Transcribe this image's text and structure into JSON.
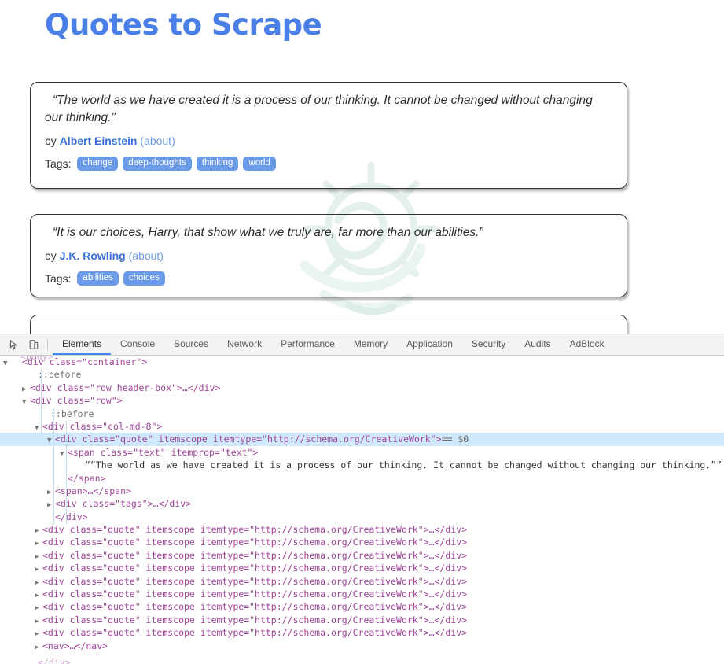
{
  "site": {
    "title": "Quotes to Scrape",
    "title_color": "#4a7fe8",
    "tag_color": "#6b9ae8",
    "author_link_color": "#3a6fd8",
    "about_link_color": "#6f9ae8",
    "by_label": "by",
    "about_label": "(about)",
    "tags_label": "Tags:",
    "watermark": "hand-holding-sun-watermark"
  },
  "quotes": [
    {
      "text": "“The world as we have created it is a process of our thinking. It cannot be changed without changing our thinking.”",
      "author": "Albert Einstein",
      "tags": [
        "change",
        "deep-thoughts",
        "thinking",
        "world"
      ]
    },
    {
      "text": "“It is our choices, Harry, that show what we truly are, far more than our abilities.”",
      "author": "J.K. Rowling",
      "tags": [
        "abilities",
        "choices"
      ]
    }
  ],
  "devtools": {
    "toolbar": {
      "inspect_icon": "inspect-element-icon",
      "device_icon": "device-toolbar-icon",
      "tabs": [
        {
          "label": "Elements",
          "active": true
        },
        {
          "label": "Console",
          "active": false
        },
        {
          "label": "Sources",
          "active": false
        },
        {
          "label": "Network",
          "active": false
        },
        {
          "label": "Performance",
          "active": false
        },
        {
          "label": "Memory",
          "active": false
        },
        {
          "label": "Application",
          "active": false
        },
        {
          "label": "Security",
          "active": false
        },
        {
          "label": "Audits",
          "active": false
        },
        {
          "label": "AdBlock",
          "active": false
        }
      ]
    },
    "tree": {
      "clipped_top": "<body>",
      "clipped_bottom": "</div>",
      "selected_marker": "== $0",
      "container_open": "<div class=\"container\">",
      "before_1": "::before",
      "header_box": "<div class=\"row header-box\">…</div>",
      "row_open": "<div class=\"row\">",
      "before_2": "::before",
      "col_open": "<div class=\"col-md-8\">",
      "quote_open": "<div class=\"quote\" itemscope itemtype=\"http://schema.org/CreativeWork\">",
      "span_text_open": "<span class=\"text\" itemprop=\"text\">",
      "quote_text_node": "““The world as we have created it is a process of our thinking. It cannot be changed without changing our thinking.””",
      "span_close": "</span>",
      "span_collapsed": "<span>…</span>",
      "tags_collapsed": "<div class=\"tags\">…</div>",
      "div_close": "</div>",
      "quote_collapsed": "<div class=\"quote\" itemscope itemtype=\"http://schema.org/CreativeWork\">…</div>",
      "collapsed_count": 9,
      "nav_collapsed": "<nav>…</nav>"
    }
  }
}
